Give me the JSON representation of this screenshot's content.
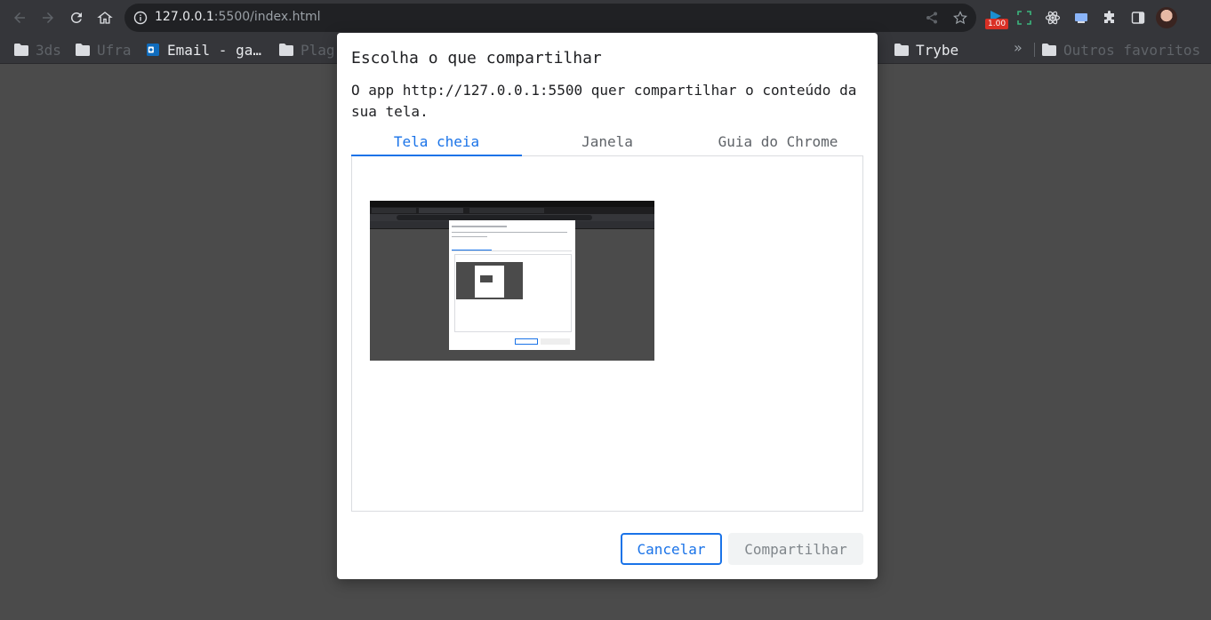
{
  "browser": {
    "url_host": "127.0.0.1",
    "url_rest": ":5500/index.html",
    "extension_badge": "1.00"
  },
  "bookmarks": {
    "items": [
      {
        "label": "3ds",
        "dimmed": true
      },
      {
        "label": "Ufra",
        "dimmed": true
      },
      {
        "label": "Email - ga…",
        "dimmed": false
      },
      {
        "label": "Plag",
        "dimmed": true
      },
      {
        "label": "Trybe",
        "dimmed": false
      }
    ],
    "overflow_chevron": "»",
    "other": "Outros favoritos"
  },
  "dialog": {
    "title": "Escolha o que compartilhar",
    "description": "O app http://127.0.0.1:5500 quer compartilhar o conteúdo da sua tela.",
    "tabs": [
      {
        "label": "Tela cheia",
        "active": true
      },
      {
        "label": "Janela",
        "active": false
      },
      {
        "label": "Guia do Chrome",
        "active": false
      }
    ],
    "cancel_label": "Cancelar",
    "share_label": "Compartilhar"
  },
  "colors": {
    "accent": "#1a73e8",
    "page_background": "#4b4b4b",
    "toolbar": "#35363a"
  }
}
